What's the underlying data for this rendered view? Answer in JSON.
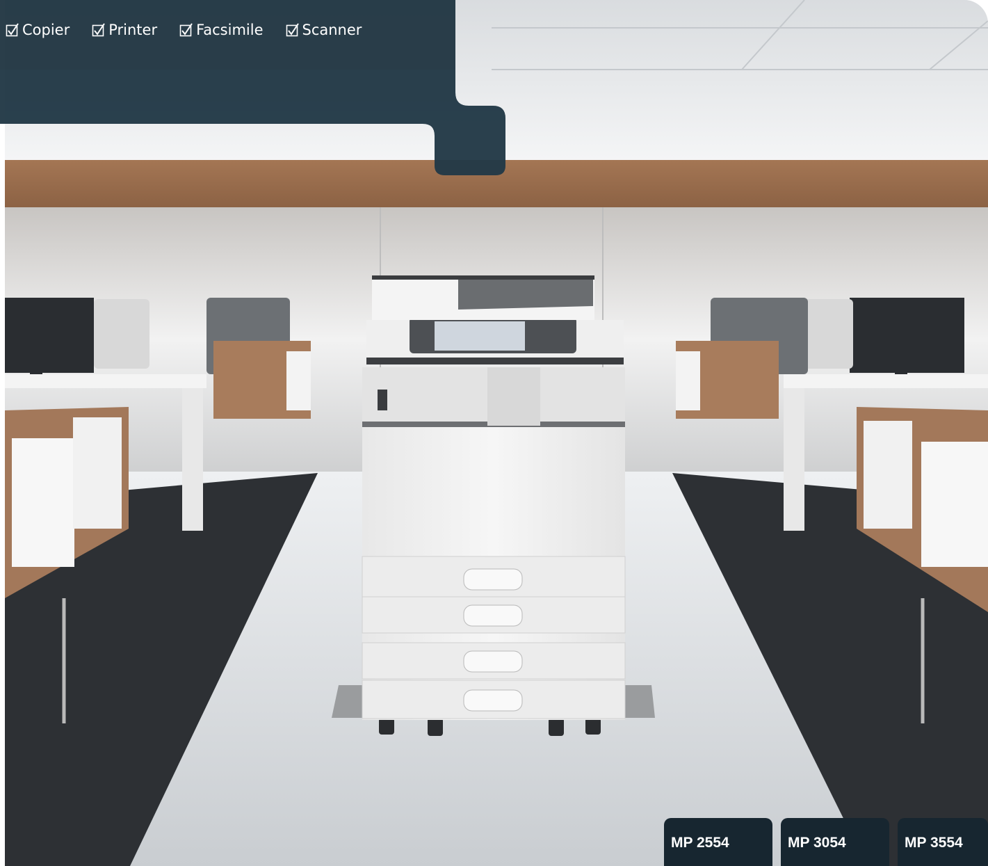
{
  "features": [
    {
      "label": "Copier",
      "icon": "checkbox-icon"
    },
    {
      "label": "Printer",
      "icon": "checkbox-icon"
    },
    {
      "label": "Facsimile",
      "icon": "checkbox-icon"
    },
    {
      "label": "Scanner",
      "icon": "checkbox-icon"
    }
  ],
  "models": [
    {
      "label": "MP 2554"
    },
    {
      "label": "MP 3054"
    },
    {
      "label": "MP 3554"
    }
  ],
  "colors": {
    "banner": "#1f3440",
    "tab": "#172630",
    "text": "#ffffff"
  }
}
